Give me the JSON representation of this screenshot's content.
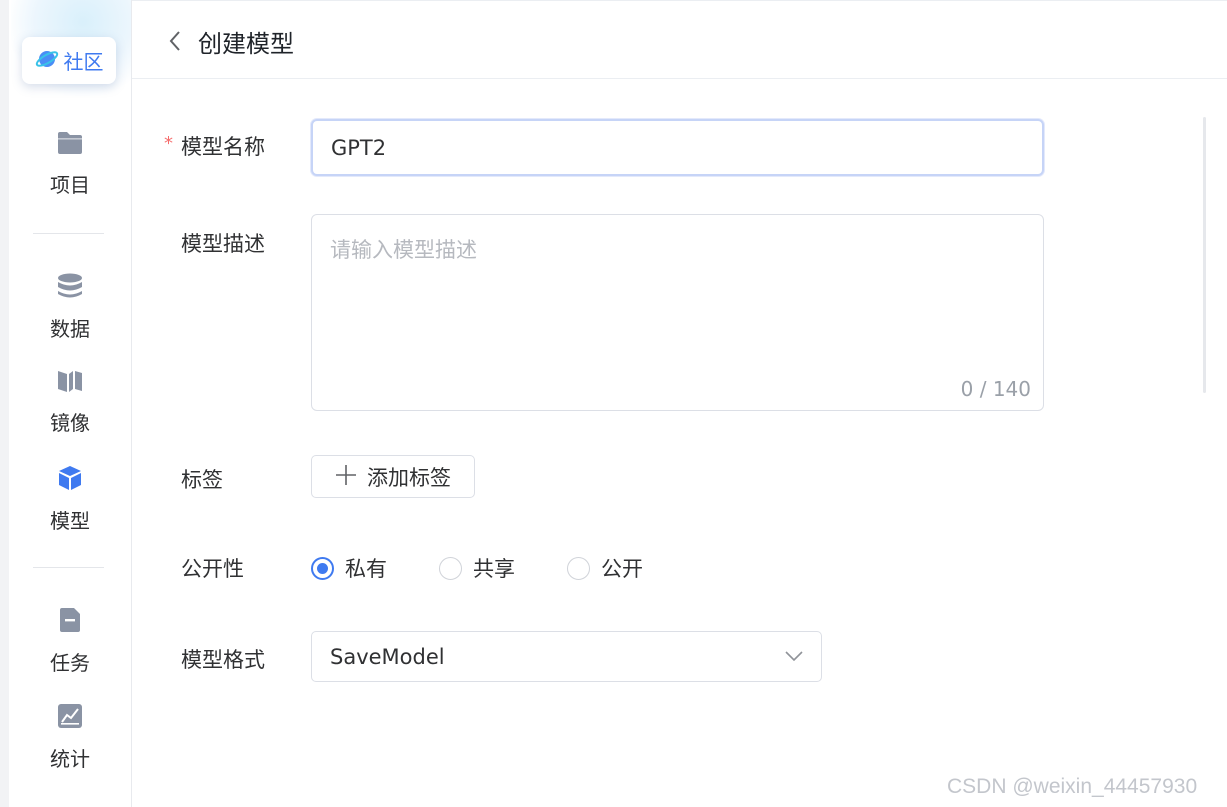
{
  "sidebar": {
    "community_label": "社区",
    "items": [
      {
        "icon": "folder-icon",
        "label": "项目"
      },
      {
        "icon": "database-icon",
        "label": "数据"
      },
      {
        "icon": "image-mirror-icon",
        "label": "镜像"
      },
      {
        "icon": "cube-icon",
        "label": "模型"
      },
      {
        "icon": "file-task-icon",
        "label": "任务"
      },
      {
        "icon": "chart-stats-icon",
        "label": "统计"
      }
    ]
  },
  "header": {
    "title": "创建模型"
  },
  "form": {
    "name": {
      "label": "模型名称",
      "required_mark": "*",
      "value": "GPT2"
    },
    "description": {
      "label": "模型描述",
      "placeholder": "请输入模型描述",
      "counter": "0 / 140"
    },
    "tags": {
      "label": "标签",
      "add_button": "添加标签"
    },
    "visibility": {
      "label": "公开性",
      "options": [
        {
          "label": "私有",
          "checked": true
        },
        {
          "label": "共享",
          "checked": false
        },
        {
          "label": "公开",
          "checked": false
        }
      ]
    },
    "format": {
      "label": "模型格式",
      "value": "SaveModel"
    }
  },
  "watermark": "CSDN @weixin_44457930",
  "colors": {
    "accent": "#3f7af0",
    "icon": "#8a93a4",
    "required": "#f56c6c"
  }
}
